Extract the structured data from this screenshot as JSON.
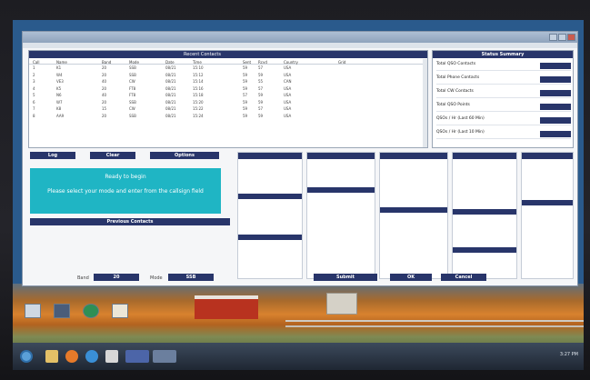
{
  "window": {
    "panel_title": "Recent Contacts",
    "status_title": "Status Summary"
  },
  "table": {
    "columns": [
      "Call",
      "Name",
      "Band",
      "Mode",
      "Date",
      "Time",
      "Sent",
      "Rcvd",
      "Country",
      "Grid"
    ],
    "rows": [
      [
        "1",
        "K1",
        "20",
        "SSB",
        "08/21",
        "15:10",
        "59",
        "57",
        "USA"
      ],
      [
        "2",
        "W4",
        "20",
        "SSB",
        "08/21",
        "15:12",
        "59",
        "59",
        "USA"
      ],
      [
        "3",
        "VE3",
        "40",
        "CW",
        "08/21",
        "15:14",
        "59",
        "55",
        "CAN"
      ],
      [
        "4",
        "K5",
        "20",
        "FT8",
        "08/21",
        "15:16",
        "59",
        "57",
        "USA"
      ],
      [
        "5",
        "N6",
        "40",
        "FT8",
        "08/21",
        "15:18",
        "57",
        "59",
        "USA"
      ],
      [
        "6",
        "W7",
        "20",
        "SSB",
        "08/21",
        "15:20",
        "59",
        "59",
        "USA"
      ],
      [
        "7",
        "K8",
        "15",
        "CW",
        "08/21",
        "15:22",
        "59",
        "57",
        "USA"
      ],
      [
        "8",
        "AA9",
        "20",
        "SSB",
        "08/21",
        "15:24",
        "59",
        "59",
        "USA"
      ]
    ]
  },
  "status": {
    "rows": [
      {
        "label": "Total QSO Contacts",
        "value": ""
      },
      {
        "label": "Total Phone Contacts",
        "value": ""
      },
      {
        "label": "Total CW Contacts",
        "value": ""
      },
      {
        "label": "Total QSO Points",
        "value": ""
      },
      {
        "label": "QSOs / Hr (Last 60 Min)",
        "value": ""
      },
      {
        "label": "QSOs / Hr (Last 10 Min)",
        "value": ""
      }
    ]
  },
  "buttons": {
    "log": "Log",
    "clear": "Clear",
    "options": "Options"
  },
  "message": {
    "line1": "Ready to begin",
    "line2": "Please select your mode and enter from the callsign field"
  },
  "prev_contacts": "Previous Contacts",
  "footer": {
    "band_label": "Band",
    "band_value": "20",
    "mode_label": "Mode",
    "mode_value": "SSB",
    "center_btn": "Submit",
    "ok_btn": "OK",
    "cancel_btn": "Cancel"
  },
  "taskbar": {
    "clock": "3:27 PM"
  }
}
